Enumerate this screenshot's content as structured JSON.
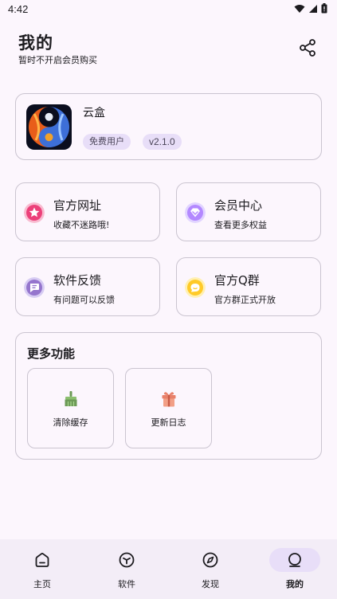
{
  "status": {
    "time": "4:42"
  },
  "header": {
    "title": "我的",
    "subtitle": "暂时不开启会员购买"
  },
  "app": {
    "name": "云盒",
    "user_type": "免费用户",
    "version": "v2.1.0"
  },
  "tiles": [
    {
      "title": "官方网址",
      "subtitle": "收藏不迷路哦!",
      "icon": "star-icon",
      "color": "#f06292"
    },
    {
      "title": "会员中心",
      "subtitle": "查看更多权益",
      "icon": "diamond-icon",
      "color": "#b388ff"
    },
    {
      "title": "软件反馈",
      "subtitle": "有问题可以反馈",
      "icon": "feedback-icon",
      "color": "#9575cd"
    },
    {
      "title": "官方Q群",
      "subtitle": "官方群正式开放",
      "icon": "chat-icon",
      "color": "#ffca28"
    }
  ],
  "more": {
    "title": "更多功能",
    "items": [
      {
        "label": "清除缓存",
        "icon": "broom-icon"
      },
      {
        "label": "更新日志",
        "icon": "gift-icon"
      }
    ]
  },
  "nav": {
    "items": [
      {
        "label": "主页",
        "icon": "home-icon",
        "active": false
      },
      {
        "label": "软件",
        "icon": "cube-icon",
        "active": false
      },
      {
        "label": "发现",
        "icon": "compass-icon",
        "active": false
      },
      {
        "label": "我的",
        "icon": "profile-icon",
        "active": true
      }
    ]
  }
}
